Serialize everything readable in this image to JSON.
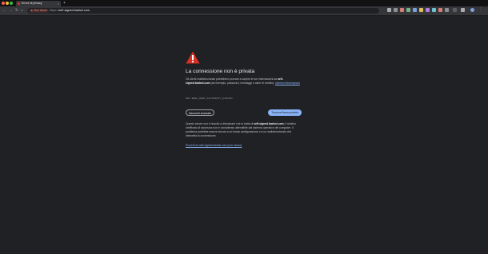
{
  "tab": {
    "title": "Errore di privacy",
    "close_glyph": "×"
  },
  "new_tab_glyph": "+",
  "nav": {
    "back_glyph": "←",
    "forward_glyph": "→",
    "reload_glyph": "↻",
    "home_glyph": "⌂"
  },
  "address_bar": {
    "security_chip": "Non sicuro",
    "url_scheme": "https://",
    "url_host": "self-signed.badssl.com"
  },
  "extension_icons": [
    "extension-icon",
    "extension-icon",
    "extension-icon",
    "extension-icon",
    "extension-icon",
    "extension-icon",
    "extension-icon",
    "extension-icon",
    "extension-icon",
    "extension-icon",
    "extension-icon",
    "extension-icon",
    "extension-icon",
    "extension-icon"
  ],
  "interstitial": {
    "heading": "La connessione non è privata",
    "explanation_prefix": "Gli utenti malintenzionati potrebbero provare a carpire le tue informazioni da ",
    "explanation_host": "self-signed.badssl.com",
    "explanation_suffix": " (ad esempio, password, messaggi o carte di credito). ",
    "learn_more": "Ulteriori informazioni",
    "error_code": "NET::ERR_CERT_AUTHORITY_INVALID",
    "advanced_button": "Nascondi avanzate",
    "back_button": "Torna nell'area protetta",
    "details_prefix": "Questo server non è riuscito a dimostrare che si tratta di ",
    "details_host": "self-signed.badssl.com",
    "details_suffix": "; il relativo certificato di sicurezza non è considerato attendibile dal sistema operativo del computer. Il problema potrebbe essere dovuto a un'errata configurazione o a un malintenzionato che intercetta la connessione.",
    "proceed_link": "Procedi su self-signed.badssl.com (non sicuro)"
  },
  "colors": {
    "background": "#202124",
    "accent": "#8ab4f8",
    "warning": "#d93025"
  }
}
